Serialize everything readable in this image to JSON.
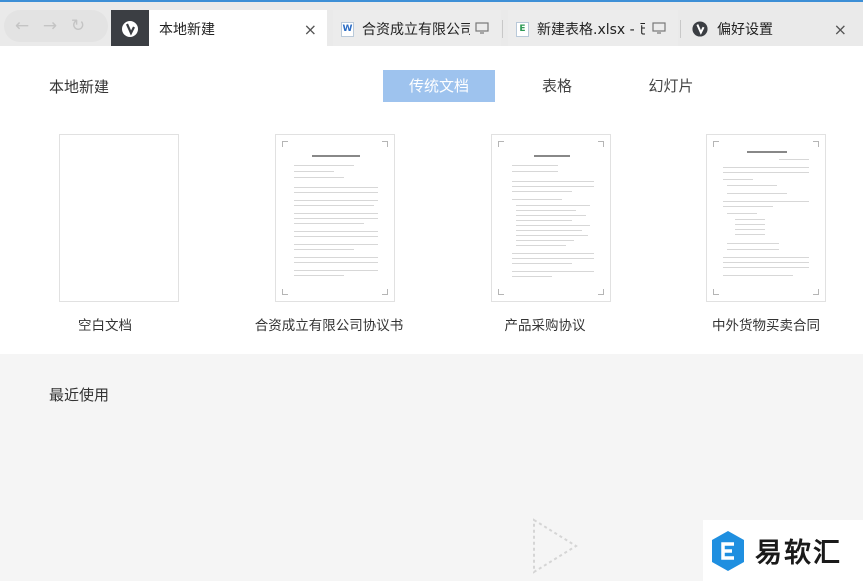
{
  "nav": {
    "back_icon": "arrow-left-icon",
    "forward_icon": "arrow-right-icon",
    "reload_icon": "refresh-icon"
  },
  "tabs": [
    {
      "title": "本地新建",
      "icon": "app-logo-icon",
      "active": true,
      "close": "×"
    },
    {
      "title": "合资成立有限公司协",
      "icon": "W",
      "icon_color": "#2b6cc4"
    },
    {
      "title": "新建表格.xlsx - 已保",
      "icon": "E",
      "icon_color": "#2f9a55"
    },
    {
      "title": "偏好设置",
      "icon": "app-logo-icon",
      "close": "×"
    }
  ],
  "new_section": {
    "title": "本地新建",
    "types": [
      "传统文档",
      "表格",
      "幻灯片"
    ],
    "selected_type": "传统文档",
    "templates": [
      {
        "label": "空白文档"
      },
      {
        "label": "合资成立有限公司协议书"
      },
      {
        "label": "产品采购协议"
      },
      {
        "label": "中外货物买卖合同"
      }
    ]
  },
  "recent_section": {
    "title": "最近使用"
  },
  "watermark": {
    "text": "易软汇"
  },
  "colors": {
    "accent": "#9ec3ee",
    "tab_strip": "#3d8fd6",
    "dark_tab": "#3b3e43"
  }
}
